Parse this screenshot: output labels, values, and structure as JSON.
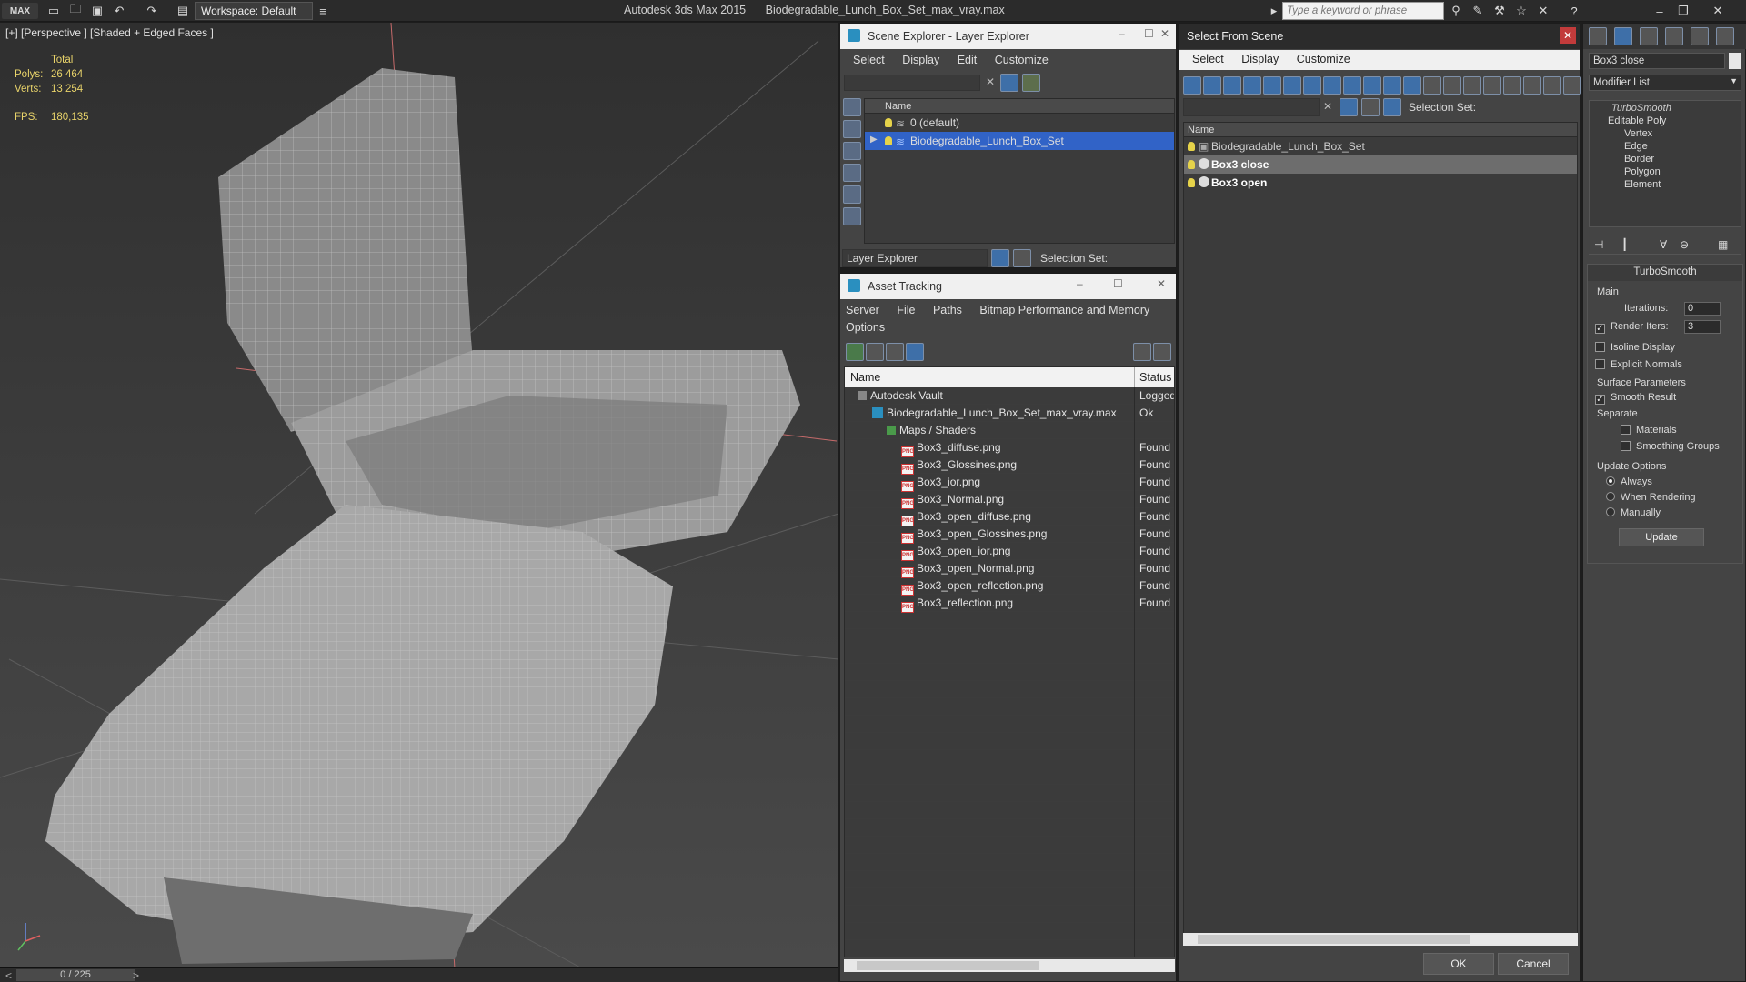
{
  "titlebar": {
    "app_name": "Autodesk 3ds Max  2015",
    "file_name": "Biodegradable_Lunch_Box_Set_max_vray.max",
    "workspace": "Workspace: Default",
    "search_placeholder": "Type a keyword or phrase",
    "logo": "MAX"
  },
  "viewport": {
    "label": "[+] [Perspective ] [Shaded + Edged Faces ]",
    "stats": {
      "total_label": "Total",
      "polys_label": "Polys:",
      "polys_value": "26 464",
      "verts_label": "Verts:",
      "verts_value": "13 254",
      "fps_label": "FPS:",
      "fps_value": "180,135"
    },
    "time_slider": "0 / 225"
  },
  "scene_explorer": {
    "title": "Scene Explorer - Layer Explorer",
    "menu": [
      "Select",
      "Display",
      "Edit",
      "Customize"
    ],
    "column": "Name",
    "layers": [
      "0 (default)",
      "Biodegradable_Lunch_Box_Set"
    ],
    "footer_mode": "Layer Explorer",
    "footer_selection_set": "Selection Set:"
  },
  "asset_tracking": {
    "title": "Asset Tracking",
    "menu": [
      "Server",
      "File",
      "Paths",
      "Bitmap Performance and Memory"
    ],
    "menu_row2": [
      "Options"
    ],
    "columns": [
      "Name",
      "Status"
    ],
    "rows": [
      {
        "name": "Autodesk Vault",
        "status": "Logged",
        "indent": 0
      },
      {
        "name": "Biodegradable_Lunch_Box_Set_max_vray.max",
        "status": "Ok",
        "indent": 1
      },
      {
        "name": "Maps / Shaders",
        "status": "",
        "indent": 2
      },
      {
        "name": "Box3_diffuse.png",
        "status": "Found",
        "indent": 3
      },
      {
        "name": "Box3_Glossines.png",
        "status": "Found",
        "indent": 3
      },
      {
        "name": "Box3_ior.png",
        "status": "Found",
        "indent": 3
      },
      {
        "name": "Box3_Normal.png",
        "status": "Found",
        "indent": 3
      },
      {
        "name": "Box3_open_diffuse.png",
        "status": "Found",
        "indent": 3
      },
      {
        "name": "Box3_open_Glossines.png",
        "status": "Found",
        "indent": 3
      },
      {
        "name": "Box3_open_ior.png",
        "status": "Found",
        "indent": 3
      },
      {
        "name": "Box3_open_Normal.png",
        "status": "Found",
        "indent": 3
      },
      {
        "name": "Box3_open_reflection.png",
        "status": "Found",
        "indent": 3
      },
      {
        "name": "Box3_reflection.png",
        "status": "Found",
        "indent": 3
      }
    ]
  },
  "select_from_scene": {
    "title": "Select From Scene",
    "menu": [
      "Select",
      "Display",
      "Customize"
    ],
    "selection_set": "Selection Set:",
    "column": "Name",
    "items": [
      "Biodegradable_Lunch_Box_Set",
      "Box3 close",
      "Box3 open"
    ],
    "ok": "OK",
    "cancel": "Cancel"
  },
  "command_panel": {
    "object_name": "Box3 close",
    "modifier_list": "Modifier List",
    "stack": [
      "TurboSmooth",
      "Editable Poly",
      "Vertex",
      "Edge",
      "Border",
      "Polygon",
      "Element"
    ],
    "rollout_title": "TurboSmooth",
    "main_label": "Main",
    "iterations_label": "Iterations:",
    "iterations_value": "0",
    "render_iters_label": "Render Iters:",
    "render_iters_value": "3",
    "isoline_display": "Isoline Display",
    "explicit_normals": "Explicit Normals",
    "surface_params": "Surface Parameters",
    "smooth_result": "Smooth Result",
    "separate": "Separate",
    "materials": "Materials",
    "smoothing_groups": "Smoothing Groups",
    "update_options": "Update Options",
    "always": "Always",
    "when_rendering": "When Rendering",
    "manually": "Manually",
    "update_button": "Update"
  },
  "colors": {
    "selection_blue": "#3163c7",
    "highlight_row": "#6d6d6d",
    "stats_yellow": "#e8d36a"
  }
}
